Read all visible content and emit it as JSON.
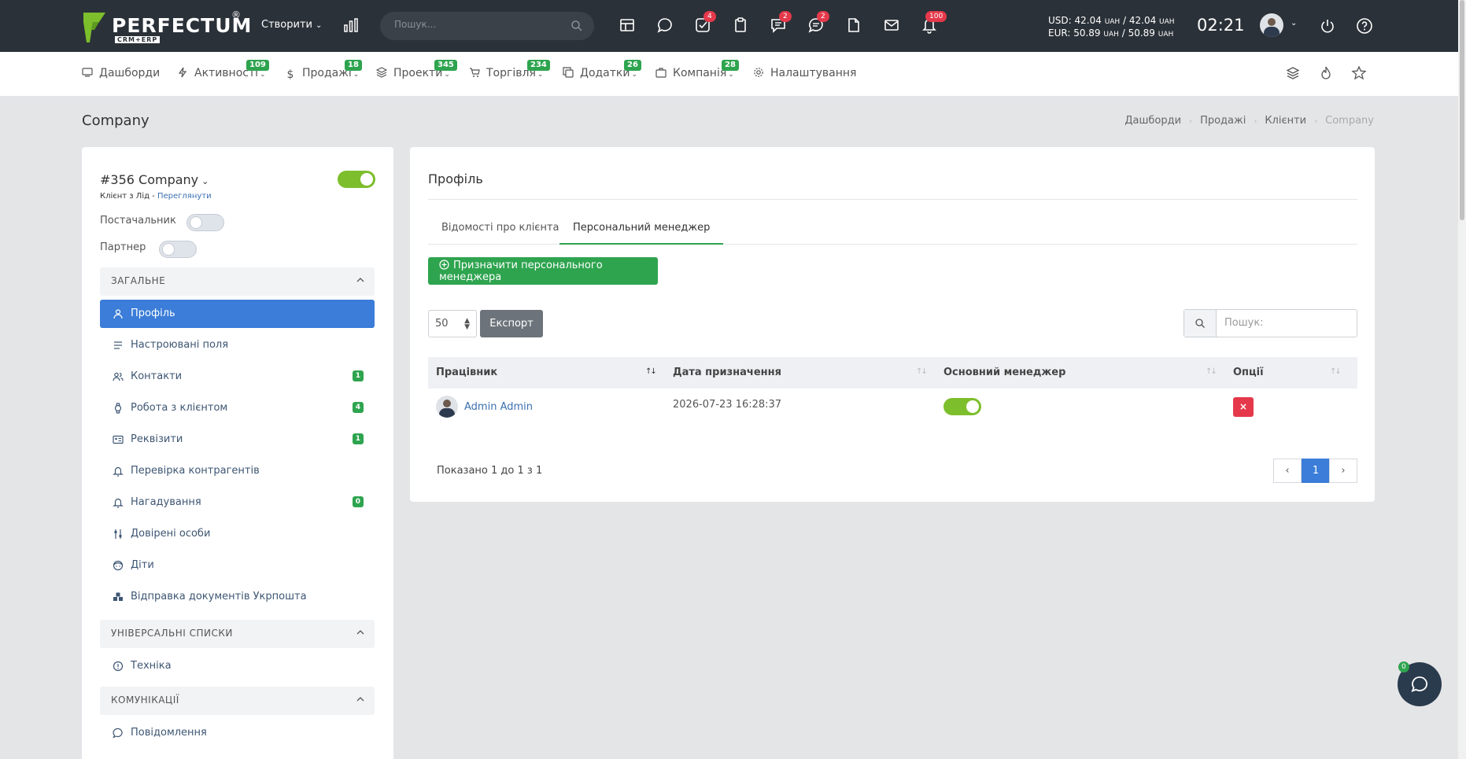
{
  "topbar": {
    "logo_text": "PERFECTUM",
    "logo_reg": "®",
    "logo_sub": "CRM+ERP",
    "create_label": "Створити",
    "search_placeholder": "Пошук...",
    "badges": {
      "tasks": "4",
      "chat": "2",
      "messages": "2",
      "notifications": "100"
    },
    "currency": {
      "usd": "USD: 42.04",
      "usd_unit": "UAH",
      "usd_sep": " / 42.04 ",
      "eur": "EUR: 50.89",
      "eur_unit": "UAH",
      "eur_sep": " / 50.89 ",
      "unit": "UAH"
    },
    "clock": "02:21"
  },
  "nav": {
    "items": [
      {
        "label": "Дашборди",
        "badge": ""
      },
      {
        "label": "Активності",
        "badge": "109"
      },
      {
        "label": "Продажі",
        "badge": "18"
      },
      {
        "label": "Проекти",
        "badge": "345"
      },
      {
        "label": "Торгівля",
        "badge": "234"
      },
      {
        "label": "Додатки",
        "badge": "26"
      },
      {
        "label": "Компанія",
        "badge": "28"
      },
      {
        "label": "Налаштування",
        "badge": ""
      }
    ]
  },
  "page": {
    "title": "Company",
    "breadcrumb": [
      "Дашборди",
      "Продажі",
      "Клієнти",
      "Company"
    ]
  },
  "client": {
    "name": "#356 Company",
    "sub_prefix": "Клієнт з Лід - ",
    "sub_link": "Переглянути",
    "supplier_label": "Постачальник",
    "partner_label": "Партнер",
    "active": true,
    "supplier": false,
    "partner": false
  },
  "sidebar": {
    "sections": [
      "ЗАГАЛЬНЕ",
      "УНІВЕРСАЛЬНІ СПИСКИ",
      "КОМУНІКАЦІЇ"
    ],
    "general": [
      {
        "label": "Профіль",
        "badge": ""
      },
      {
        "label": "Настроювані поля",
        "badge": ""
      },
      {
        "label": "Контакти",
        "badge": "1"
      },
      {
        "label": "Робота з клієнтом",
        "badge": "4"
      },
      {
        "label": "Реквізити",
        "badge": "1"
      },
      {
        "label": "Перевірка контрагентів",
        "badge": ""
      },
      {
        "label": "Нагадування",
        "badge": "0"
      },
      {
        "label": "Довірені особи",
        "badge": ""
      },
      {
        "label": "Діти",
        "badge": ""
      },
      {
        "label": "Відправка документів Укрпошта",
        "badge": ""
      }
    ],
    "lists": [
      {
        "label": "Техніка"
      }
    ],
    "comms": [
      {
        "label": "Повідомлення"
      }
    ]
  },
  "main": {
    "title": "Профіль",
    "tabs": [
      "Відомості про клієнта",
      "Персональний менеджер"
    ],
    "assign_label": "Призначити персонального менеджера",
    "page_size": "50",
    "export_label": "Експорт",
    "search_placeholder": "Пошук:",
    "columns": [
      "Працівник",
      "Дата призначення",
      "Основний менеджер",
      "Опції"
    ],
    "rows": [
      {
        "employee": "Admin Admin",
        "date": "2026-07-23 16:28:37",
        "primary": true,
        "delete": "×"
      }
    ],
    "showing": "Показано 1 до 1 з 1",
    "pager": {
      "prev": "‹",
      "current": "1",
      "next": "›"
    }
  },
  "chat": {
    "badge": "0"
  },
  "colors": {
    "topbar": "#2b3138",
    "accent_blue": "#3b7dd8",
    "accent_green": "#2ea44f",
    "danger": "#e5394b",
    "toggle_on": "#7dbe2c"
  }
}
